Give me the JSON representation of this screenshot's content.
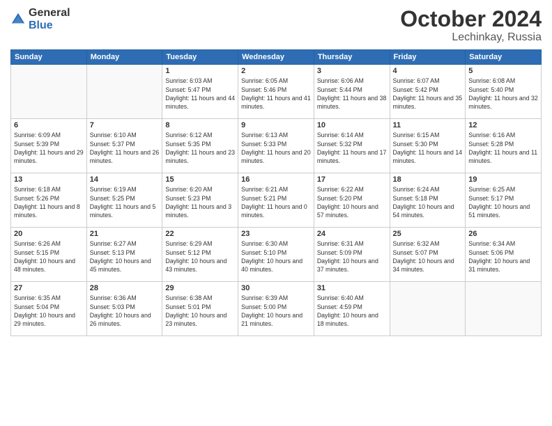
{
  "logo": {
    "general": "General",
    "blue": "Blue"
  },
  "header": {
    "month": "October 2024",
    "location": "Lechinkay, Russia"
  },
  "weekdays": [
    "Sunday",
    "Monday",
    "Tuesday",
    "Wednesday",
    "Thursday",
    "Friday",
    "Saturday"
  ],
  "weeks": [
    [
      {
        "day": null,
        "info": null
      },
      {
        "day": null,
        "info": null
      },
      {
        "day": "1",
        "info": "Sunrise: 6:03 AM\nSunset: 5:47 PM\nDaylight: 11 hours and 44 minutes."
      },
      {
        "day": "2",
        "info": "Sunrise: 6:05 AM\nSunset: 5:46 PM\nDaylight: 11 hours and 41 minutes."
      },
      {
        "day": "3",
        "info": "Sunrise: 6:06 AM\nSunset: 5:44 PM\nDaylight: 11 hours and 38 minutes."
      },
      {
        "day": "4",
        "info": "Sunrise: 6:07 AM\nSunset: 5:42 PM\nDaylight: 11 hours and 35 minutes."
      },
      {
        "day": "5",
        "info": "Sunrise: 6:08 AM\nSunset: 5:40 PM\nDaylight: 11 hours and 32 minutes."
      }
    ],
    [
      {
        "day": "6",
        "info": "Sunrise: 6:09 AM\nSunset: 5:39 PM\nDaylight: 11 hours and 29 minutes."
      },
      {
        "day": "7",
        "info": "Sunrise: 6:10 AM\nSunset: 5:37 PM\nDaylight: 11 hours and 26 minutes."
      },
      {
        "day": "8",
        "info": "Sunrise: 6:12 AM\nSunset: 5:35 PM\nDaylight: 11 hours and 23 minutes."
      },
      {
        "day": "9",
        "info": "Sunrise: 6:13 AM\nSunset: 5:33 PM\nDaylight: 11 hours and 20 minutes."
      },
      {
        "day": "10",
        "info": "Sunrise: 6:14 AM\nSunset: 5:32 PM\nDaylight: 11 hours and 17 minutes."
      },
      {
        "day": "11",
        "info": "Sunrise: 6:15 AM\nSunset: 5:30 PM\nDaylight: 11 hours and 14 minutes."
      },
      {
        "day": "12",
        "info": "Sunrise: 6:16 AM\nSunset: 5:28 PM\nDaylight: 11 hours and 11 minutes."
      }
    ],
    [
      {
        "day": "13",
        "info": "Sunrise: 6:18 AM\nSunset: 5:26 PM\nDaylight: 11 hours and 8 minutes."
      },
      {
        "day": "14",
        "info": "Sunrise: 6:19 AM\nSunset: 5:25 PM\nDaylight: 11 hours and 5 minutes."
      },
      {
        "day": "15",
        "info": "Sunrise: 6:20 AM\nSunset: 5:23 PM\nDaylight: 11 hours and 3 minutes."
      },
      {
        "day": "16",
        "info": "Sunrise: 6:21 AM\nSunset: 5:21 PM\nDaylight: 11 hours and 0 minutes."
      },
      {
        "day": "17",
        "info": "Sunrise: 6:22 AM\nSunset: 5:20 PM\nDaylight: 10 hours and 57 minutes."
      },
      {
        "day": "18",
        "info": "Sunrise: 6:24 AM\nSunset: 5:18 PM\nDaylight: 10 hours and 54 minutes."
      },
      {
        "day": "19",
        "info": "Sunrise: 6:25 AM\nSunset: 5:17 PM\nDaylight: 10 hours and 51 minutes."
      }
    ],
    [
      {
        "day": "20",
        "info": "Sunrise: 6:26 AM\nSunset: 5:15 PM\nDaylight: 10 hours and 48 minutes."
      },
      {
        "day": "21",
        "info": "Sunrise: 6:27 AM\nSunset: 5:13 PM\nDaylight: 10 hours and 45 minutes."
      },
      {
        "day": "22",
        "info": "Sunrise: 6:29 AM\nSunset: 5:12 PM\nDaylight: 10 hours and 43 minutes."
      },
      {
        "day": "23",
        "info": "Sunrise: 6:30 AM\nSunset: 5:10 PM\nDaylight: 10 hours and 40 minutes."
      },
      {
        "day": "24",
        "info": "Sunrise: 6:31 AM\nSunset: 5:09 PM\nDaylight: 10 hours and 37 minutes."
      },
      {
        "day": "25",
        "info": "Sunrise: 6:32 AM\nSunset: 5:07 PM\nDaylight: 10 hours and 34 minutes."
      },
      {
        "day": "26",
        "info": "Sunrise: 6:34 AM\nSunset: 5:06 PM\nDaylight: 10 hours and 31 minutes."
      }
    ],
    [
      {
        "day": "27",
        "info": "Sunrise: 6:35 AM\nSunset: 5:04 PM\nDaylight: 10 hours and 29 minutes."
      },
      {
        "day": "28",
        "info": "Sunrise: 6:36 AM\nSunset: 5:03 PM\nDaylight: 10 hours and 26 minutes."
      },
      {
        "day": "29",
        "info": "Sunrise: 6:38 AM\nSunset: 5:01 PM\nDaylight: 10 hours and 23 minutes."
      },
      {
        "day": "30",
        "info": "Sunrise: 6:39 AM\nSunset: 5:00 PM\nDaylight: 10 hours and 21 minutes."
      },
      {
        "day": "31",
        "info": "Sunrise: 6:40 AM\nSunset: 4:59 PM\nDaylight: 10 hours and 18 minutes."
      },
      {
        "day": null,
        "info": null
      },
      {
        "day": null,
        "info": null
      }
    ]
  ]
}
